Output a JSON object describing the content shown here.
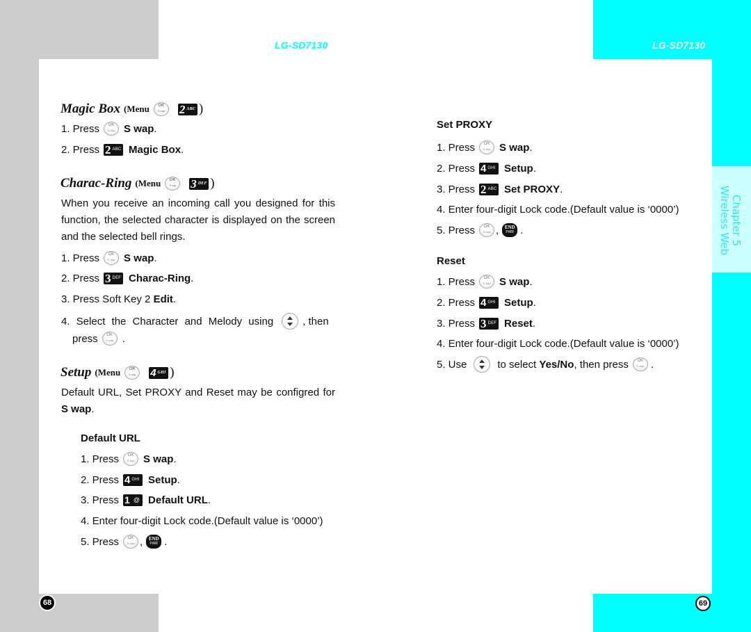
{
  "header": {
    "model_left": "LG-SD7130",
    "model_right": "LG-SD7130"
  },
  "side_tab": {
    "chapter": "Chapter 5",
    "title": "Wireless Web"
  },
  "page_numbers": {
    "left": "68",
    "right": "69"
  },
  "colors": {
    "accent_cyan": "#00ffff",
    "pale_cyan": "#ccffff",
    "gray": "#cccccc"
  },
  "icons": {
    "ok_key": "ok-swap-key-icon",
    "key_1": {
      "digit": "1",
      "letters": "@"
    },
    "key_2": {
      "digit": "2",
      "letters": "ABC"
    },
    "key_3": {
      "digit": "3",
      "letters": "DEF"
    },
    "key_4": {
      "digit": "4",
      "letters": "GHI"
    },
    "end_key": "end-pwr-key-icon",
    "nav_key": "up-down-navigation-key-icon"
  },
  "left_page": {
    "magic_box": {
      "title": "Magic Box",
      "menu_prefix": "(Menu",
      "menu_suffix": ")",
      "steps": [
        {
          "num": "1. Press",
          "bold": "S wap",
          "end": "."
        },
        {
          "num": "2. Press",
          "bold": "Magic Box",
          "end": "."
        }
      ]
    },
    "charac_ring": {
      "title": "Charac-Ring",
      "menu_prefix": "(Menu",
      "menu_suffix": ")",
      "description": "When you receive an incoming call you designed for this function, the selected character is displayed on the screen and the selected bell rings.",
      "steps": [
        {
          "num": "1. Press",
          "bold": "S wap",
          "end": "."
        },
        {
          "num": "2. Press",
          "bold": "Charac-Ring",
          "end": "."
        },
        {
          "num": "3. Press Soft Key 2",
          "bold": "Edit",
          "end": "."
        },
        {
          "num": "4. Select the Character and Melody using",
          "after_icon": ", then",
          "line2": "press",
          "end": "."
        }
      ]
    },
    "setup": {
      "title": "Setup",
      "menu_prefix": "(Menu",
      "menu_suffix": ")",
      "description_pre": "Default URL, Set PROXY and Reset may be configred for",
      "description_bold": "S wap",
      "description_end": ".",
      "default_url": {
        "heading": "Default URL",
        "steps": [
          {
            "num": "1. Press",
            "bold": "S wap",
            "end": "."
          },
          {
            "num": "2. Press",
            "bold": "Setup",
            "end": "."
          },
          {
            "num": "3. Press",
            "bold": "Default URL",
            "end": "."
          },
          {
            "num": "4. Enter four-digit Lock code.(Default value is ‘0000’)"
          },
          {
            "num": "5. Press",
            "sep": ",",
            "end": "."
          }
        ]
      }
    }
  },
  "right_page": {
    "set_proxy": {
      "heading": "Set PROXY",
      "steps": [
        {
          "num": "1. Press",
          "bold": "S wap",
          "end": "."
        },
        {
          "num": "2. Press",
          "bold": "Setup",
          "end": "."
        },
        {
          "num": "3. Press",
          "bold": "Set PROXY",
          "end": "."
        },
        {
          "num": "4. Enter four-digit Lock code.(Default value is ‘0000’)"
        },
        {
          "num": "5. Press",
          "sep": ",",
          "end": "."
        }
      ]
    },
    "reset": {
      "heading": "Reset",
      "steps": [
        {
          "num": "1. Press",
          "bold": "S wap",
          "end": "."
        },
        {
          "num": "2. Press",
          "bold": "Setup",
          "end": "."
        },
        {
          "num": "3. Press",
          "bold": "Reset",
          "end": "."
        },
        {
          "num": "4. Enter four-digit Lock code.(Default value is ‘0000’)"
        },
        {
          "num": "5. Use",
          "mid": "to select",
          "bold": "Yes/No",
          "mid2": ", then press",
          "end": "."
        }
      ]
    }
  }
}
